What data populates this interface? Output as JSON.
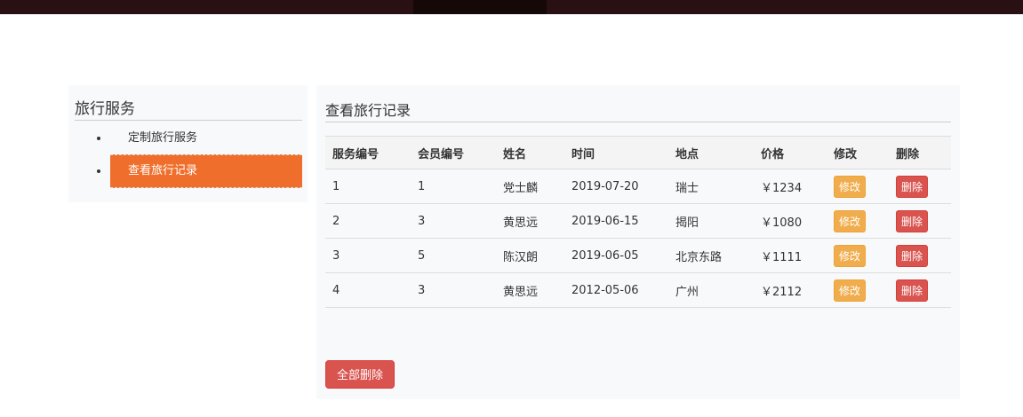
{
  "sidebar": {
    "title": "旅行服务",
    "items": [
      {
        "label": "定制旅行服务"
      },
      {
        "label": "查看旅行记录"
      }
    ]
  },
  "main": {
    "title": "查看旅行记录",
    "columns": [
      "服务编号",
      "会员编号",
      "姓名",
      "时间",
      "地点",
      "价格",
      "修改",
      "删除"
    ],
    "rows": [
      [
        "1",
        "1",
        "党士麟",
        "2019-07-20",
        "瑞士",
        "￥1234"
      ],
      [
        "2",
        "3",
        "黄思远",
        "2019-06-15",
        "揭阳",
        "￥1080"
      ],
      [
        "3",
        "5",
        "陈汉朗",
        "2019-06-05",
        "北京东路",
        "￥1111"
      ],
      [
        "4",
        "3",
        "黄思远",
        "2012-05-06",
        "广州",
        "￥2112"
      ]
    ],
    "edit_label": "修改",
    "delete_label": "删除",
    "delete_all_label": "全部删除"
  }
}
